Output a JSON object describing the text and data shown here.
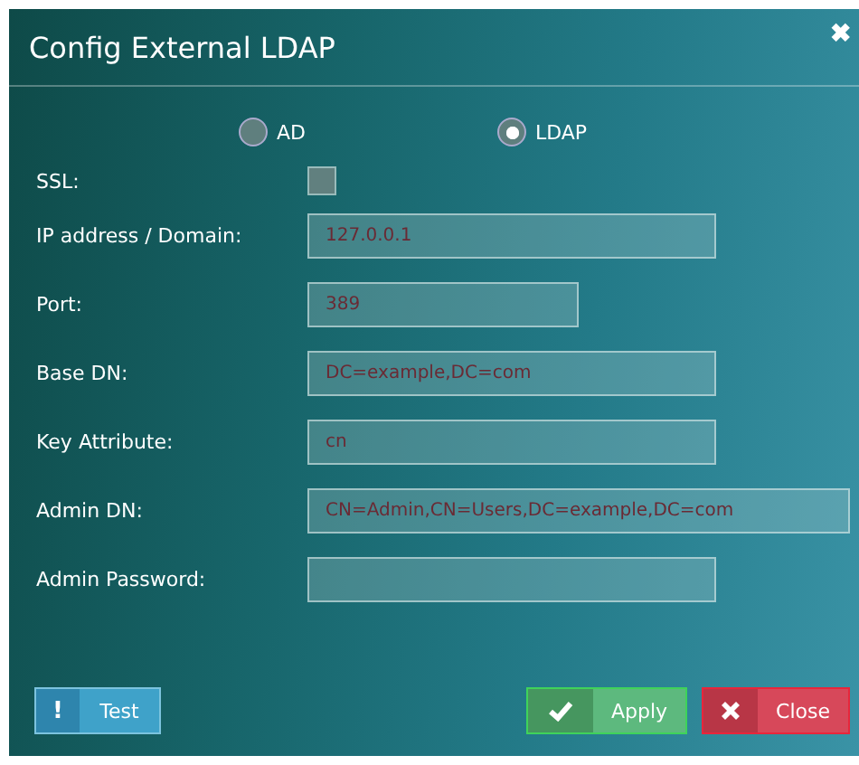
{
  "window": {
    "title": "Config External LDAP",
    "close": "✖"
  },
  "modes": [
    {
      "label": "AD",
      "selected": false
    },
    {
      "label": "LDAP",
      "selected": true
    }
  ],
  "fields": [
    {
      "kind": "checkbox",
      "label": "SSL:",
      "checked": false
    },
    {
      "kind": "text",
      "label": "IP address / Domain:",
      "placeholder": "127.0.0.1"
    },
    {
      "kind": "text",
      "label": "Port:",
      "placeholder": "389"
    },
    {
      "kind": "text",
      "label": "Base DN:",
      "placeholder": "DC=example,DC=com"
    },
    {
      "kind": "text",
      "label": "Key Attribute:",
      "placeholder": "cn"
    },
    {
      "kind": "text",
      "label": "Admin DN:",
      "placeholder": "CN=Admin,CN=Users,DC=example,DC=com"
    },
    {
      "kind": "password",
      "label": "Admin Password:"
    }
  ],
  "buttons": [
    {
      "kind": "test",
      "label": "Test",
      "icon": "!"
    },
    {
      "kind": "apply",
      "label": "Apply"
    },
    {
      "kind": "close",
      "label": "Close"
    }
  ]
}
